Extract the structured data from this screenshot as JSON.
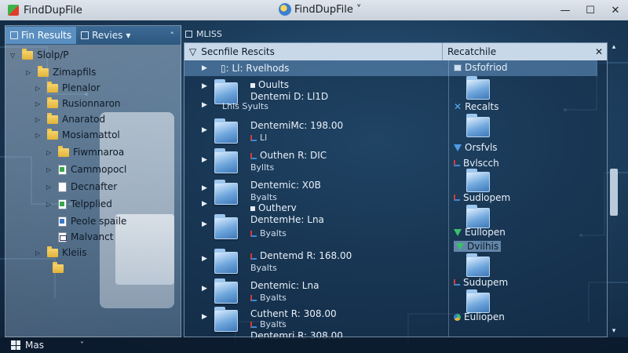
{
  "app": {
    "title": "FindDupFile",
    "center_title": "FindDupFile",
    "center_caret": "˅",
    "window_buttons": [
      "—",
      "☐",
      "✕"
    ]
  },
  "left_pane": {
    "tabs": [
      {
        "label": "Fin Results",
        "active": true
      },
      {
        "label": "Revies",
        "active": false
      }
    ],
    "collapse_glyph": "˄",
    "tree": [
      {
        "label": "Slolp/P",
        "level": 0,
        "expanded": true,
        "icon": "folder-icon"
      },
      {
        "label": "Zimapfils",
        "level": 1,
        "icon": "folder-icon"
      },
      {
        "label": "Plenalor",
        "level": 1,
        "icon": "folder-icon"
      },
      {
        "label": "Rusionnaron",
        "level": 1,
        "icon": "folder-icon"
      },
      {
        "label": "Anaratod",
        "level": 1,
        "icon": "folder-icon"
      },
      {
        "label": "Mosiamattol",
        "level": 1,
        "icon": "folder-icon"
      },
      {
        "label": "Fiwmnaroa",
        "level": 2,
        "icon": "folder-icon"
      },
      {
        "label": "Cammopocl",
        "level": 2,
        "icon": "green-doc-icon"
      },
      {
        "label": "Decnafter",
        "level": 2,
        "icon": "doc-icon"
      },
      {
        "label": "Telpplied",
        "level": 2,
        "icon": "green-doc-icon"
      },
      {
        "label": "Peole spaile",
        "level": 2,
        "icon": "doc-icon"
      },
      {
        "label": "Malvanct",
        "level": 2,
        "icon": "mail-doc-icon"
      },
      {
        "label": "Kleiis",
        "level": 1,
        "icon": "folder-icon"
      },
      {
        "label": "",
        "level": 2,
        "icon": "folder-icon"
      }
    ]
  },
  "right_area": {
    "tab_label": "MLISS",
    "panel": {
      "header_left": "Secnfile Rescits",
      "header_right": "Recatchile",
      "close": "✕",
      "selected_row": "Ll: Rvelhods",
      "rows": [
        {
          "line1": "Ll: Rvelhods",
          "line2": "",
          "selected": true
        },
        {
          "line1": "Ouults",
          "line2": "Lhls Syults"
        },
        {
          "line1": "Dentemi D: Ll1D",
          "line2": ""
        },
        {
          "line1": "DentemiMc: 198.00",
          "line2": "Ll"
        },
        {
          "line1": "Outhen R: DIC",
          "line2": "Byllts"
        },
        {
          "line1": "Dentemic: X0B",
          "line2": "Byalts"
        },
        {
          "line1": "Outherv",
          "line2": ""
        },
        {
          "line1": "DentemHe: Lna",
          "line2": "Byalts"
        },
        {
          "line1": "Dentemd R: 168.00",
          "line2": "Byalts"
        },
        {
          "line1": "Dentemic: Lna",
          "line2": "Byalts"
        },
        {
          "line1": "Cuthent R: 308.00",
          "line2": "Byalts"
        },
        {
          "line1": "Dentemri R: 308.00",
          "line2": ""
        }
      ],
      "right_items": [
        "Dsfofriod",
        "Recalts",
        "Orsfvls",
        "Bvlscch",
        "Sudlopem",
        "Eullopen",
        "Dvilhis",
        "Sudupem",
        "Euliopen"
      ]
    }
  },
  "statusbar": {
    "label": "Mas",
    "caret": "˅"
  }
}
